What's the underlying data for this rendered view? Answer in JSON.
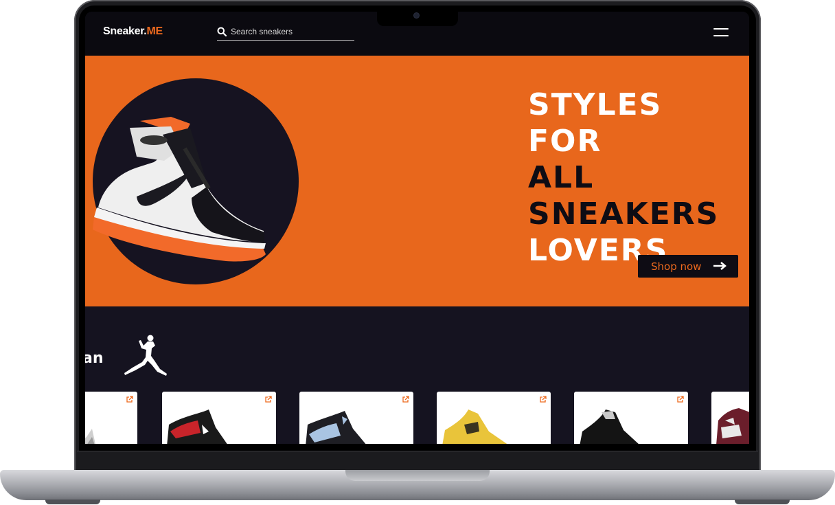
{
  "nav": {
    "logo_main": "Sneaker.",
    "logo_accent": "ME",
    "search_placeholder": "Search sneakers",
    "icons": {
      "search": "search-icon",
      "menu": "hamburger-menu-icon"
    }
  },
  "hero": {
    "headline_lines": [
      {
        "text": "STYLES",
        "tone": "light"
      },
      {
        "text": "FOR",
        "tone": "light"
      },
      {
        "text": "ALL",
        "tone": "dark"
      },
      {
        "text": "SNEAKERS",
        "tone": "dark"
      },
      {
        "text": "LOVERS",
        "tone": "light"
      }
    ],
    "cta_label": "Shop now",
    "cta_icon": "arrow-right-icon"
  },
  "brand": {
    "partial_text": "an",
    "logo_icon": "jumpman-logo-icon"
  },
  "products": [
    {
      "name": "product-card-1",
      "shoe_color": "#d9d9d9",
      "accent": "#9a9a9a",
      "icon": "external-link-icon"
    },
    {
      "name": "product-card-2",
      "shoe_color": "#1a1a1a",
      "accent": "#c8242a",
      "icon": "external-link-icon"
    },
    {
      "name": "product-card-3",
      "shoe_color": "#1e1e24",
      "accent": "#a9c4e2",
      "icon": "external-link-icon"
    },
    {
      "name": "product-card-4",
      "shoe_color": "#e9c43a",
      "accent": "#3a3420",
      "icon": "external-link-icon"
    },
    {
      "name": "product-card-5",
      "shoe_color": "#141414",
      "accent": "#c9c9c9",
      "icon": "external-link-icon"
    },
    {
      "name": "product-card-6",
      "shoe_color": "#6b1e2b",
      "accent": "#e8e8e8",
      "icon": "external-link-icon"
    }
  ],
  "colors": {
    "accent_orange": "#e8671c",
    "brand_orange": "#ee6a1e",
    "dark_bg": "#151320",
    "nav_bg": "#0b0a10"
  }
}
